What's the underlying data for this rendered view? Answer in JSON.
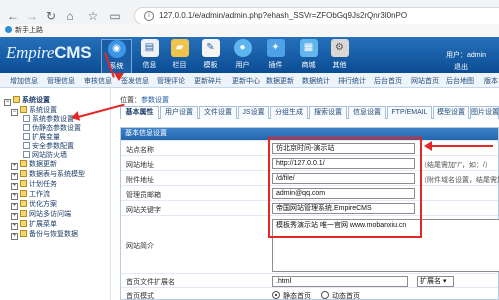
{
  "browser": {
    "url": "127.0.0.1/e/admin/admin.php?ehash_SSVr=ZFObGq9Js2rQnr3l0nPO",
    "bookmark": "新手上路"
  },
  "header": {
    "logo_main": "Empire",
    "logo_suffix": "CMS",
    "modules": [
      {
        "label": "系统",
        "icon": "globe"
      },
      {
        "label": "信息",
        "icon": "document"
      },
      {
        "label": "栏目",
        "icon": "folder"
      },
      {
        "label": "模板",
        "icon": "template"
      },
      {
        "label": "用户",
        "icon": "user"
      },
      {
        "label": "插件",
        "icon": "plugin"
      },
      {
        "label": "商城",
        "icon": "cart"
      },
      {
        "label": "其他",
        "icon": "tools"
      }
    ],
    "user_info": "用户：admin",
    "logout": "退出"
  },
  "function_bar": {
    "items": [
      "增加信息",
      "管理信息",
      "审核信息",
      "签发信息",
      "管理评论",
      "更新碎片",
      "更新中心",
      "数据更新",
      "数据统计",
      "排行统计",
      "后台首页",
      "网站首页",
      "后台地图",
      "版本"
    ]
  },
  "sidebar": {
    "items": [
      {
        "label": "系统设置",
        "level": 0,
        "icon": "folder"
      },
      {
        "label": "系统设置",
        "level": 1,
        "icon": "folder"
      },
      {
        "label": "系统参数设置",
        "level": 2,
        "icon": "page"
      },
      {
        "label": "伪静态参数设置",
        "level": 2,
        "icon": "page"
      },
      {
        "label": "扩展变量",
        "level": 2,
        "icon": "page"
      },
      {
        "label": "安全参数配置",
        "level": 2,
        "icon": "page"
      },
      {
        "label": "网站防火墙",
        "level": 2,
        "icon": "page"
      },
      {
        "label": "数据更新",
        "level": 1,
        "icon": "folder"
      },
      {
        "label": "数据表与系统模型",
        "level": 1,
        "icon": "folder"
      },
      {
        "label": "计划任务",
        "level": 1,
        "icon": "folder"
      },
      {
        "label": "工作流",
        "level": 1,
        "icon": "folder"
      },
      {
        "label": "优化方案",
        "level": 1,
        "icon": "folder"
      },
      {
        "label": "网站多访问端",
        "level": 1,
        "icon": "folder"
      },
      {
        "label": "扩展菜单",
        "level": 1,
        "icon": "folder"
      },
      {
        "label": "备份与恢复数据",
        "level": 1,
        "icon": "folder"
      }
    ]
  },
  "main": {
    "breadcrumb_prefix": "位置：",
    "breadcrumb": "参数设置",
    "tabs": [
      "基本属性",
      "用户设置",
      "文件设置",
      "JS设置",
      "分组生成",
      "搜索设置",
      "信息设置",
      "FTP/EMAIL",
      "模型设置",
      "图片设置"
    ],
    "section_title": "基本信息设置",
    "fields": [
      {
        "label": "站点名称",
        "value": "仿北京时间-演示站",
        "note": ""
      },
      {
        "label": "网站地址",
        "value": "http://127.0.0.1/",
        "note": "（结尾需加\"/\"，如：/）"
      },
      {
        "label": "附件地址",
        "value": "/d/file/",
        "note": "（附件域名设置，结尾需加\"/\"）"
      },
      {
        "label": "管理员邮箱",
        "value": "admin@qq.com",
        "note": ""
      },
      {
        "label": "网站关键字",
        "value": "帝国网站管理系统,EmpireCMS",
        "note": ""
      },
      {
        "label": "网站简介",
        "value": "模板秀演示站 唯一官网 www.mobanxiu.cn",
        "note": ""
      },
      {
        "label": "首页文件扩展名",
        "value": ".html",
        "note": ""
      },
      {
        "label": "首页模式",
        "value": "",
        "note": ""
      }
    ],
    "extension_select": "扩展名",
    "home_mode_options": [
      "静态首页",
      "动态首页"
    ],
    "home_mode_selected": "静态首页"
  },
  "annotations": {
    "color": "#e32626"
  }
}
